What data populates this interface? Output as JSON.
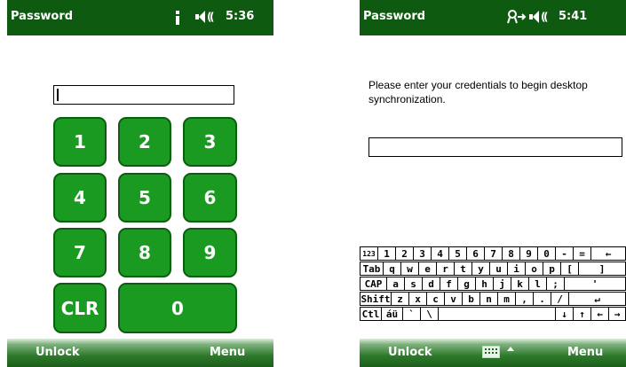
{
  "screen_a": {
    "title": "Password",
    "time": "5:36",
    "pin_value": "",
    "keys": [
      "1",
      "2",
      "3",
      "4",
      "5",
      "6",
      "7",
      "8",
      "9",
      "CLR",
      "0"
    ],
    "softkeys": {
      "left": "Unlock",
      "right": "Menu"
    }
  },
  "screen_b": {
    "title": "Password",
    "time": "5:41",
    "message": "Please enter your credentials to begin desktop synchronization.",
    "credential_value": "",
    "keyboard": {
      "row1": [
        "123",
        "1",
        "2",
        "3",
        "4",
        "5",
        "6",
        "7",
        "8",
        "9",
        "0",
        "-",
        "=",
        "←"
      ],
      "row2": [
        "Tab",
        "q",
        "w",
        "e",
        "r",
        "t",
        "y",
        "u",
        "i",
        "o",
        "p",
        "[",
        "]"
      ],
      "row3": [
        "CAP",
        "a",
        "s",
        "d",
        "f",
        "g",
        "h",
        "j",
        "k",
        "l",
        ";",
        "'"
      ],
      "row4": [
        "Shift",
        "z",
        "x",
        "c",
        "v",
        "b",
        "n",
        "m",
        ",",
        ".",
        "/",
        "↵"
      ],
      "row5": [
        "Ctl",
        "áü",
        "`",
        "\\",
        "",
        "↓",
        "↑",
        "←",
        "→"
      ]
    },
    "softkeys": {
      "left": "Unlock",
      "right": "Menu"
    }
  },
  "colors": {
    "titlebar": "#0e5a10",
    "key_fill": "#1a9a21",
    "key_border": "#0b5d10"
  }
}
